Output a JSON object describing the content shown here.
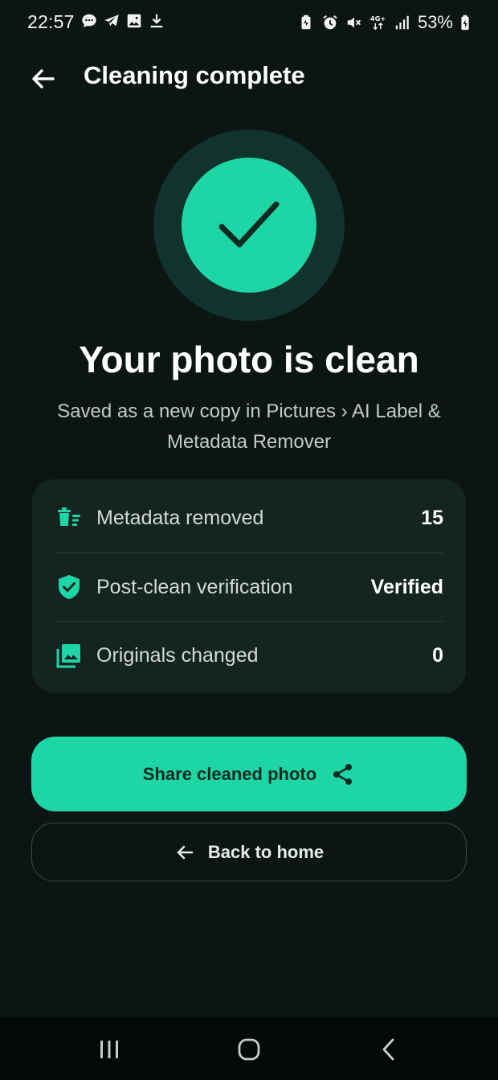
{
  "status_bar": {
    "time": "22:57",
    "battery": "53%",
    "left_icons": [
      "chat-bubble-icon",
      "telegram-icon",
      "image-icon",
      "download-icon"
    ],
    "right_icons": [
      "battery-saver-icon",
      "alarm-icon",
      "mute-icon",
      "4g-plus-icon",
      "signal-icon",
      "battery-charging-icon"
    ]
  },
  "app_bar": {
    "title": "Cleaning complete",
    "back_icon": "arrow-left-icon"
  },
  "hero": {
    "icon": "checkmark-icon",
    "headline": "Your photo is clean",
    "subtitle": "Saved as a new copy in Pictures › AI Label & Metadata Remover"
  },
  "stats": [
    {
      "icon": "delete-sweep-icon",
      "label": "Metadata removed",
      "value": "15"
    },
    {
      "icon": "shield-check-icon",
      "label": "Post-clean verification",
      "value": "Verified"
    },
    {
      "icon": "photo-library-icon",
      "label": "Originals changed",
      "value": "0"
    }
  ],
  "actions": {
    "share_label": "Share cleaned photo",
    "share_icon": "share-icon",
    "back_label": "Back to home",
    "back_icon": "arrow-left-icon"
  },
  "nav_bar": {
    "buttons": [
      "recents-icon",
      "home-icon",
      "back-icon"
    ]
  },
  "colors": {
    "background": "#0b1614",
    "accent": "#1ed6a5",
    "card": "#142421",
    "accent_ring": "#11332b"
  }
}
